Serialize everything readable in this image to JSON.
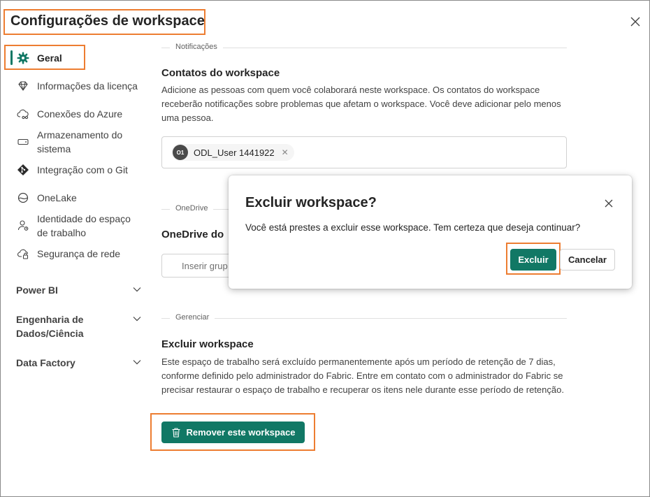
{
  "dialog": {
    "title": "Configurações de workspace",
    "close_icon": "close-icon"
  },
  "sidebar": {
    "items": [
      {
        "label": "Geral",
        "icon": "gear-icon",
        "active": true
      },
      {
        "label": "Informações da licença",
        "icon": "diamond-icon"
      },
      {
        "label": "Conexões do Azure",
        "icon": "cloud-link-icon"
      },
      {
        "label": "Armazenamento do sistema",
        "icon": "storage-icon"
      },
      {
        "label": "Integração com o Git",
        "icon": "git-icon"
      },
      {
        "label": "OneLake",
        "icon": "onelake-icon"
      },
      {
        "label": "Identidade do espaço de trabalho",
        "icon": "identity-icon"
      },
      {
        "label": "Segurança de rede",
        "icon": "cloud-lock-icon"
      }
    ],
    "groups": [
      {
        "label": "Power BI"
      },
      {
        "label": "Engenharia de Dados/Ciência"
      },
      {
        "label": "Data Factory"
      }
    ]
  },
  "notifications": {
    "section_label": "Notificações",
    "heading": "Contatos do workspace",
    "description": "Adicione as pessoas com quem você colaborará neste workspace. Os contatos do workspace receberão notificações sobre problemas que afetam o workspace. Você deve adicionar pelo menos uma pessoa.",
    "contact_initials": "O1",
    "contact_name": "ODL_User 1441922"
  },
  "onedrive": {
    "section_label": "OneDrive",
    "heading": "OneDrive do",
    "input_placeholder": "Inserir grup"
  },
  "manage": {
    "section_label": "Gerenciar",
    "heading": "Excluir workspace",
    "description": "Este espaço de trabalho será excluído permanentemente após um período de retenção de 7 dias, conforme definido pelo administrador do Fabric. Entre em contato com o administrador do Fabric se precisar restaurar o espaço de trabalho e recuperar os itens nele durante esse período de retenção.",
    "remove_button": "Remover este workspace"
  },
  "modal": {
    "title": "Excluir workspace?",
    "message": "Você está prestes a excluir esse workspace. Tem certeza que deseja continuar?",
    "confirm": "Excluir",
    "cancel": "Cancelar"
  },
  "colors": {
    "accent": "#117865",
    "highlight": "#ed7d31"
  }
}
